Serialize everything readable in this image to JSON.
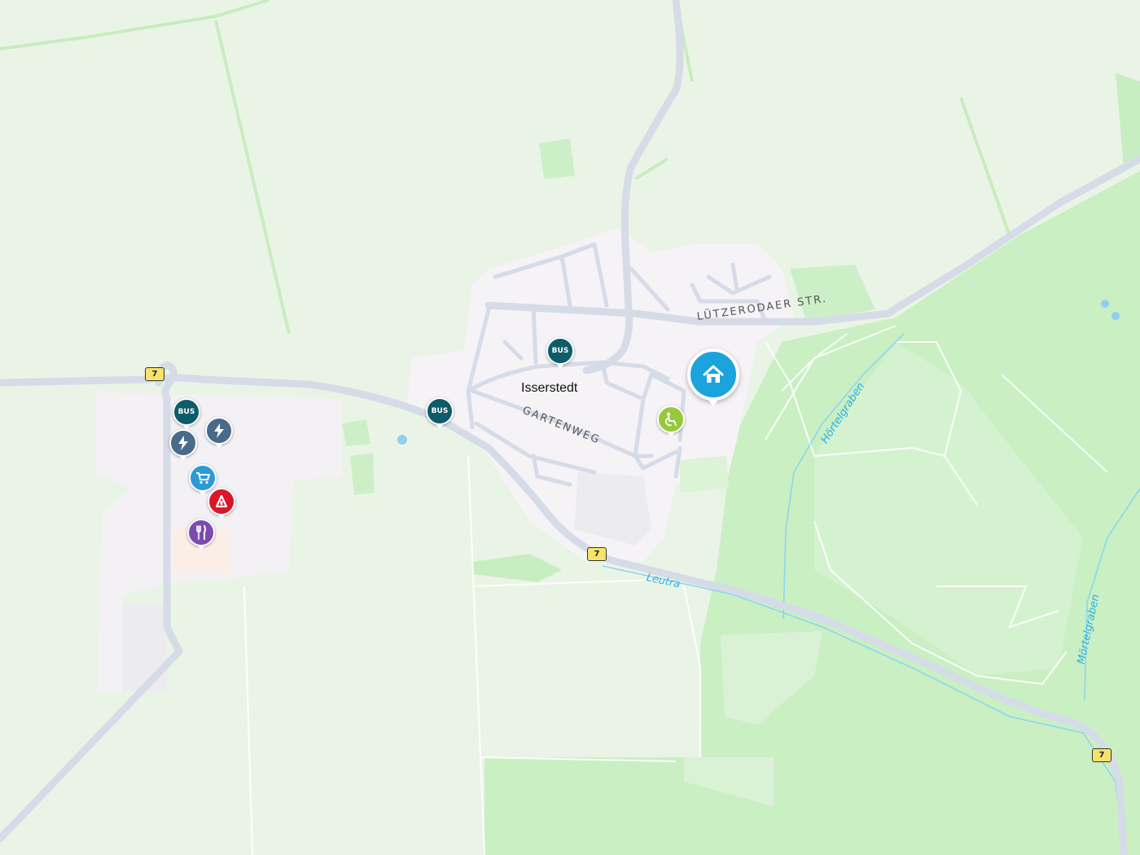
{
  "map": {
    "town_label": "Isserstedt",
    "streets": [
      {
        "name": "LÜTZERODAER STR."
      },
      {
        "name": "GARTENWEG"
      }
    ],
    "waterways": [
      {
        "name": "Leutra"
      },
      {
        "name": "Hörtelgraben"
      },
      {
        "name": "Mörtelgraben"
      }
    ],
    "road_shields": [
      "7",
      "7",
      "7"
    ],
    "home_marker": {
      "icon": "home-icon",
      "color": "#1aa3dd"
    },
    "pois": [
      {
        "type": "bus-stop",
        "label": "BUS",
        "icon": "bus-icon",
        "color": "#0e5b69"
      },
      {
        "type": "bus-stop",
        "label": "BUS",
        "icon": "bus-icon",
        "color": "#0e5b69"
      },
      {
        "type": "bus-stop",
        "label": "BUS",
        "icon": "bus-icon",
        "color": "#0e5b69"
      },
      {
        "type": "ev-charging",
        "label": "",
        "icon": "lightning-icon",
        "color": "#4a6a8a"
      },
      {
        "type": "ev-charging",
        "label": "",
        "icon": "lightning-icon",
        "color": "#4a6a8a"
      },
      {
        "type": "supermarket",
        "label": "",
        "icon": "shopping-cart-icon",
        "color": "#2b9ad6"
      },
      {
        "type": "pharmacy",
        "label": "",
        "icon": "pharmacy-icon",
        "color": "#d8172a"
      },
      {
        "type": "restaurant",
        "label": "",
        "icon": "fork-knife-icon",
        "color": "#7d4bb0"
      },
      {
        "type": "care-facility",
        "label": "",
        "icon": "wheelchair-icon",
        "color": "#96c93d"
      }
    ]
  }
}
